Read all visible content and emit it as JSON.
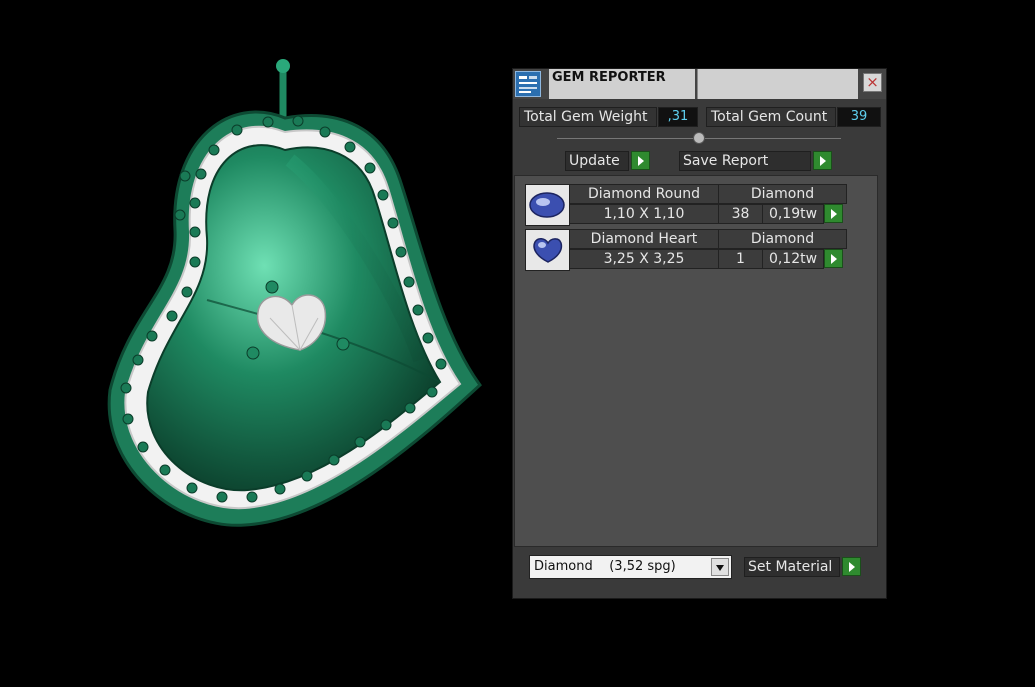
{
  "gem_reporter": {
    "title": "GEM REPORTER",
    "close_label": "×",
    "total_gem_weight_label": "Total Gem Weight",
    "total_gem_weight_value": ",31",
    "total_gem_count_label": "Total Gem Count",
    "total_gem_count_value": "39",
    "update_label": "Update",
    "save_report_label": "Save Report",
    "set_material_label": "Set Material",
    "material_select_value": "Diamond    (3,52 spg)",
    "gems": [
      {
        "shape": "Diamond Round",
        "material": "Diamond",
        "size": "1,10 X 1,10",
        "count": "38",
        "weight": "0,19tw",
        "icon": "round-gem-icon"
      },
      {
        "shape": "Diamond Heart",
        "material": "Diamond",
        "size": "3,25 X 3,25",
        "count": "1",
        "weight": "0,12tw",
        "icon": "heart-gem-icon"
      }
    ]
  },
  "colors": {
    "pendant_metal": "#1f8a62",
    "panel_bg": "#3a3a3a",
    "accent_value": "#5fd0f0",
    "go_button": "#2f8a2f"
  }
}
